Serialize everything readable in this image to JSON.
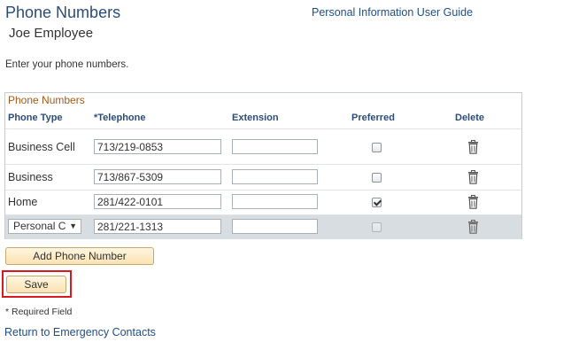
{
  "header": {
    "title": "Phone Numbers",
    "guide_link": "Personal Information User Guide",
    "employee_name": "Joe Employee"
  },
  "instructions": "Enter your phone numbers.",
  "grid": {
    "title": "Phone Numbers",
    "columns": {
      "phone_type": "Phone Type",
      "telephone": "*Telephone",
      "extension": "Extension",
      "preferred": "Preferred",
      "delete": "Delete"
    },
    "rows": [
      {
        "type": "Business Cell",
        "telephone": "713/219-0853",
        "extension": "",
        "preferred": false,
        "type_is_dropdown": false
      },
      {
        "type": "Business",
        "telephone": "713/867-5309",
        "extension": "",
        "preferred": false,
        "type_is_dropdown": false
      },
      {
        "type": "Home",
        "telephone": "281/422-0101",
        "extension": "",
        "preferred": true,
        "type_is_dropdown": false
      },
      {
        "type": "Personal C",
        "telephone": "281/221-1313",
        "extension": "",
        "preferred": false,
        "type_is_dropdown": true
      }
    ]
  },
  "buttons": {
    "add_phone": "Add Phone Number",
    "save": "Save"
  },
  "required_note": "* Required Field",
  "return_link": "Return to Emergency Contacts",
  "icons": {
    "delete": "trash-icon",
    "dropdown": "chevron-down-icon"
  },
  "colors": {
    "title": "#2a4d7a",
    "grid_title": "#a35b19",
    "link": "#1f4e89",
    "highlight_outline": "#d8191f",
    "button_fill": "#fbe2b3"
  }
}
